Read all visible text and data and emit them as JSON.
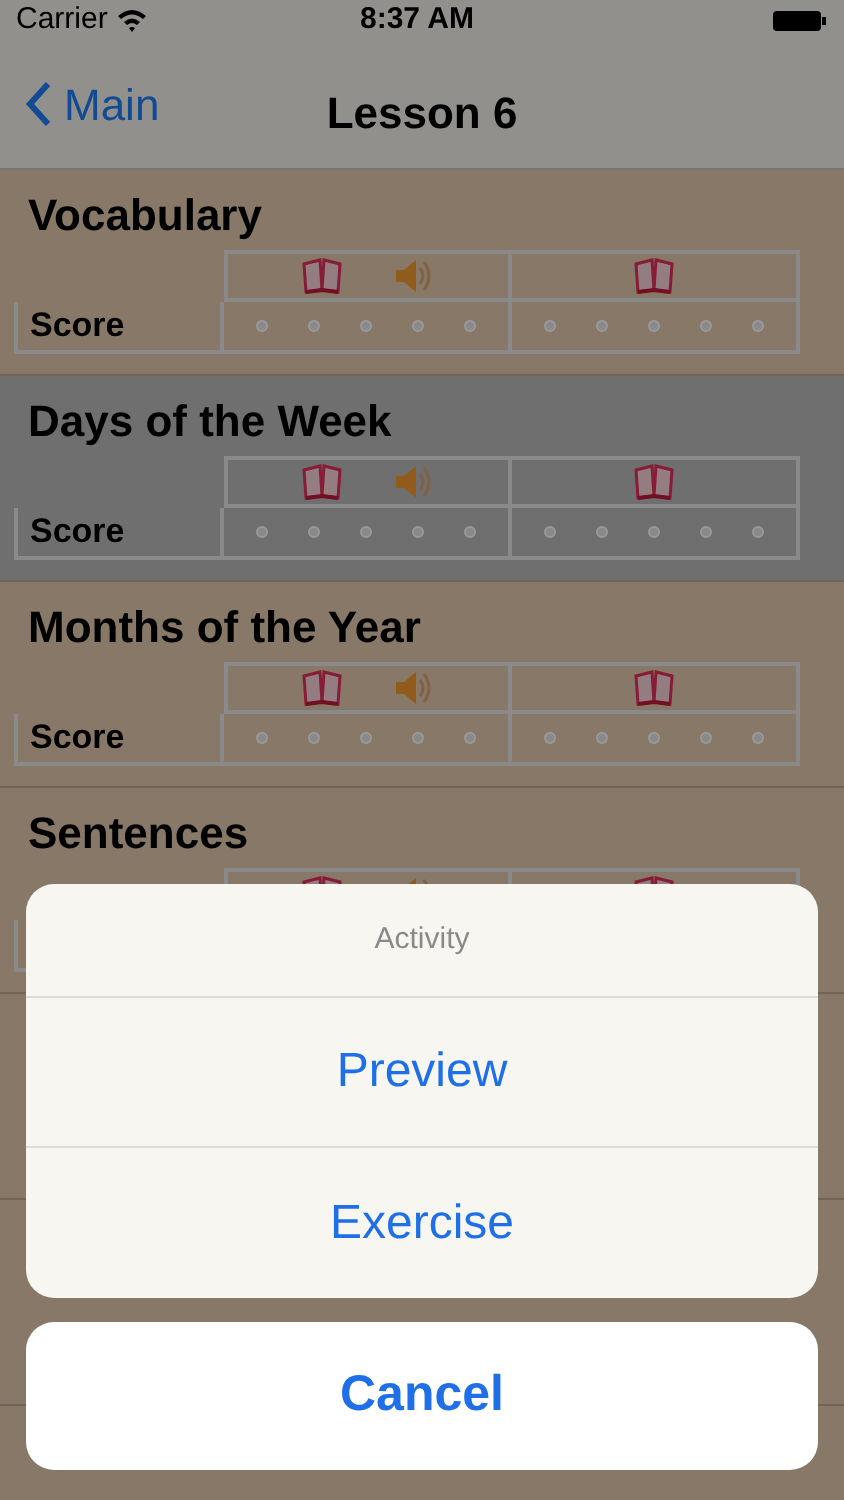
{
  "status_bar": {
    "carrier": "Carrier",
    "time": "8:37 AM"
  },
  "nav": {
    "back": "Main",
    "title": "Lesson 6"
  },
  "sections": [
    {
      "title": "Vocabulary",
      "selected": false,
      "score_label": "Score"
    },
    {
      "title": "Days of the Week",
      "selected": true,
      "score_label": "Score"
    },
    {
      "title": "Months of the Year",
      "selected": false,
      "score_label": "Score"
    },
    {
      "title": "Sentences",
      "selected": false
    }
  ],
  "action_sheet": {
    "title": "Activity",
    "actions": [
      "Preview",
      "Exercise"
    ],
    "cancel": "Cancel"
  }
}
